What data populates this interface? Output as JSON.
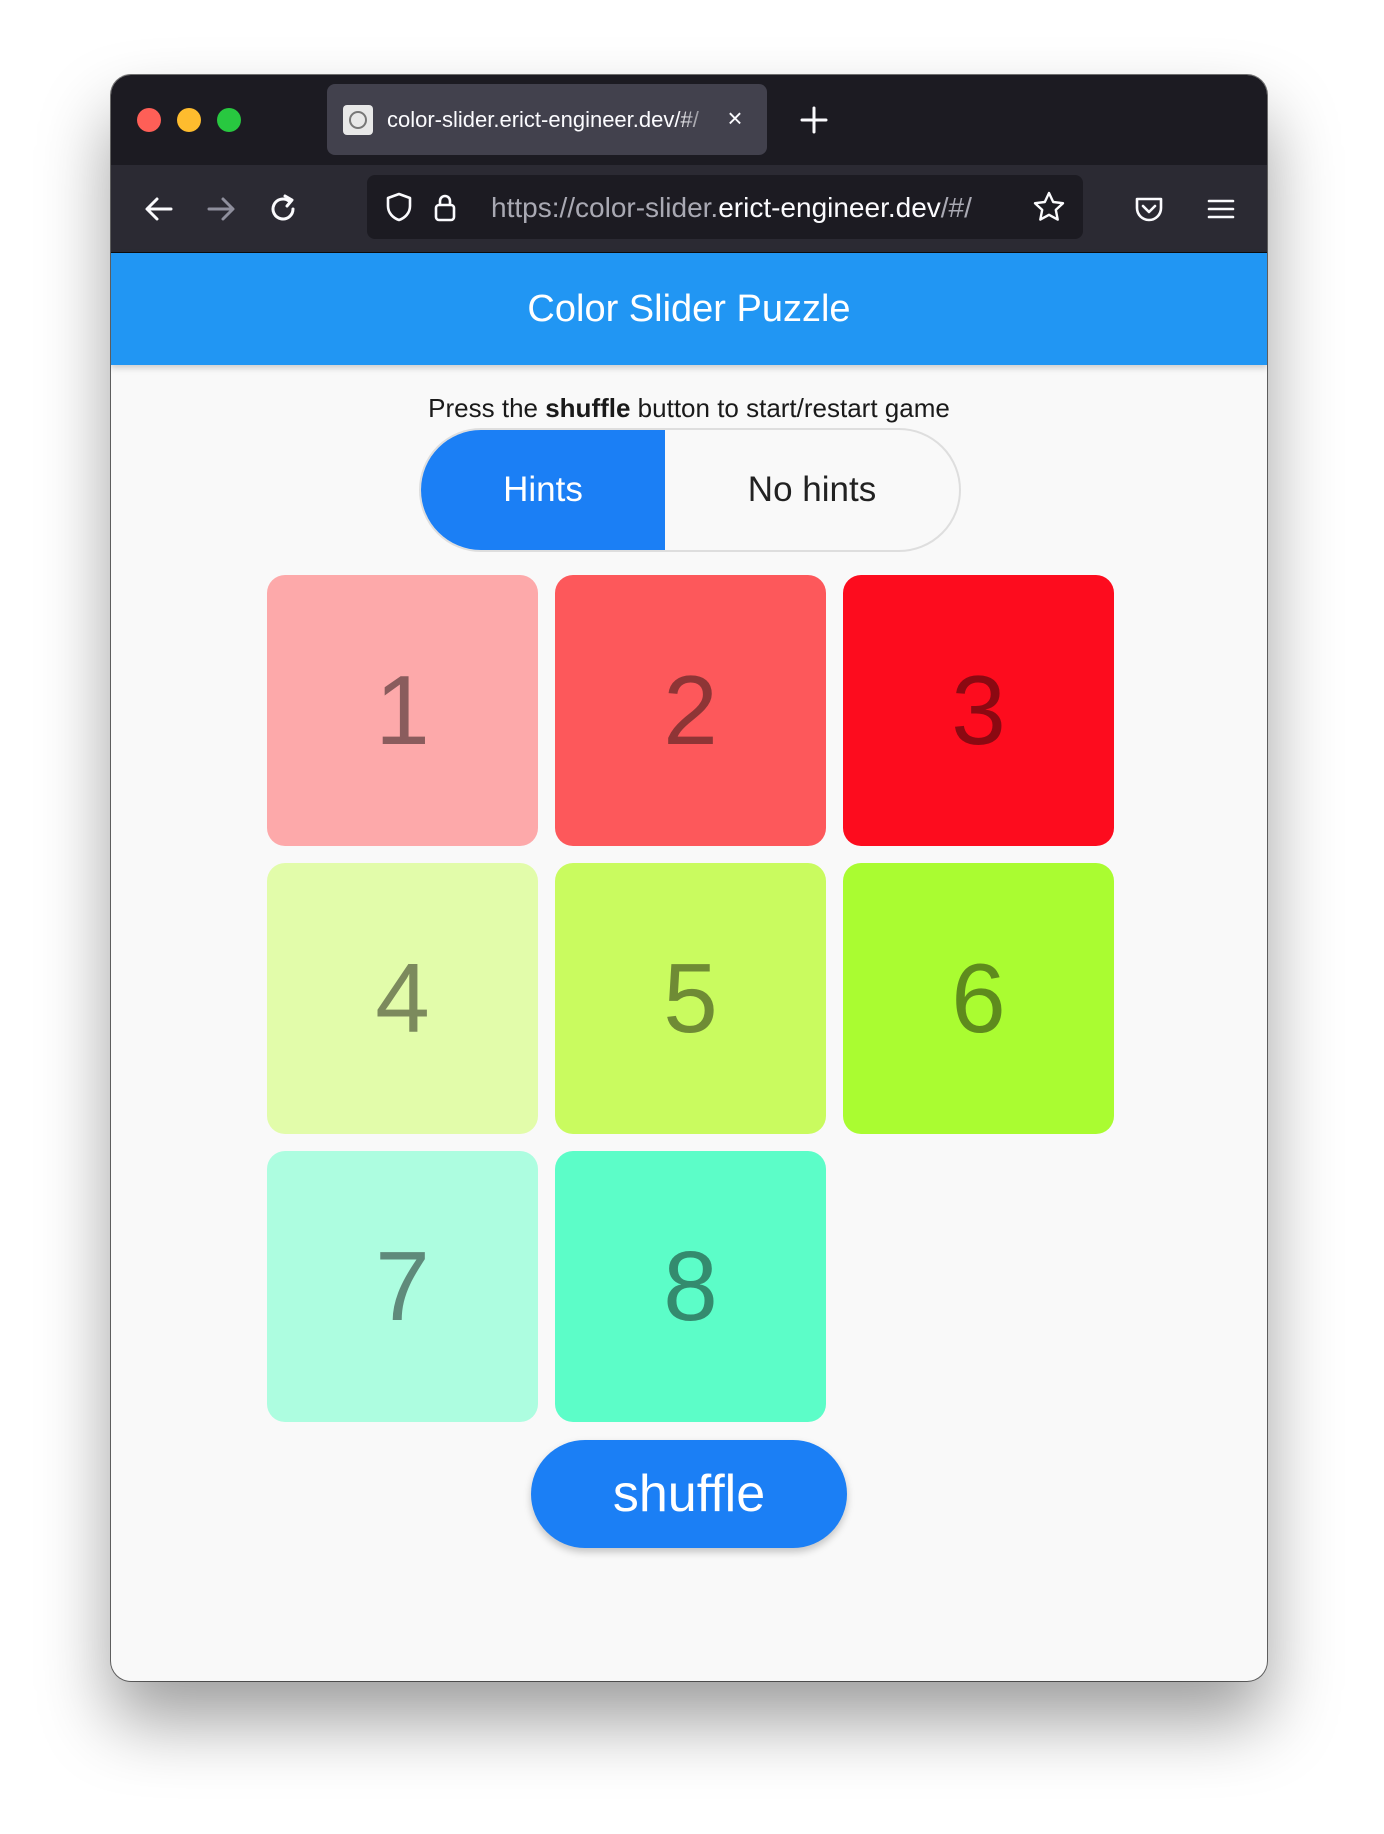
{
  "browser": {
    "tab_title": "color-slider.erict-engineer.dev/#/",
    "tab_close": "×",
    "url_prefix": "https://color-slider.",
    "url_domain": "erict-engineer.dev",
    "url_suffix": "/#/"
  },
  "app": {
    "title": "Color Slider Puzzle",
    "instruction_pre": "Press the ",
    "instruction_bold": "shuffle",
    "instruction_post": " button to start/restart game",
    "hint_toggle": {
      "hints_label": "Hints",
      "no_hints_label": "No hints",
      "selected": "Hints"
    },
    "shuffle_label": "shuffle"
  },
  "board": {
    "rows": 3,
    "cols": 3,
    "empty_cell": {
      "row": 2,
      "col": 2
    },
    "tiles": [
      {
        "label": "1",
        "row": 0,
        "col": 0,
        "bg": "#fda9aa",
        "fg": "#8a5c5d"
      },
      {
        "label": "2",
        "row": 0,
        "col": 1,
        "bg": "#fd585b",
        "fg": "#8e3536"
      },
      {
        "label": "3",
        "row": 0,
        "col": 2,
        "bg": "#fd0c1e",
        "fg": "#8b0912"
      },
      {
        "label": "4",
        "row": 1,
        "col": 0,
        "bg": "#e2fcaa",
        "fg": "#7c8a5d"
      },
      {
        "label": "5",
        "row": 1,
        "col": 1,
        "bg": "#c9fb5f",
        "fg": "#6f8b35"
      },
      {
        "label": "6",
        "row": 1,
        "col": 2,
        "bg": "#aafc31",
        "fg": "#5e8b1d"
      },
      {
        "label": "7",
        "row": 2,
        "col": 0,
        "bg": "#adfde0",
        "fg": "#5f8a7b"
      },
      {
        "label": "8",
        "row": 2,
        "col": 1,
        "bg": "#5cfdc8",
        "fg": "#348b6e"
      }
    ]
  }
}
